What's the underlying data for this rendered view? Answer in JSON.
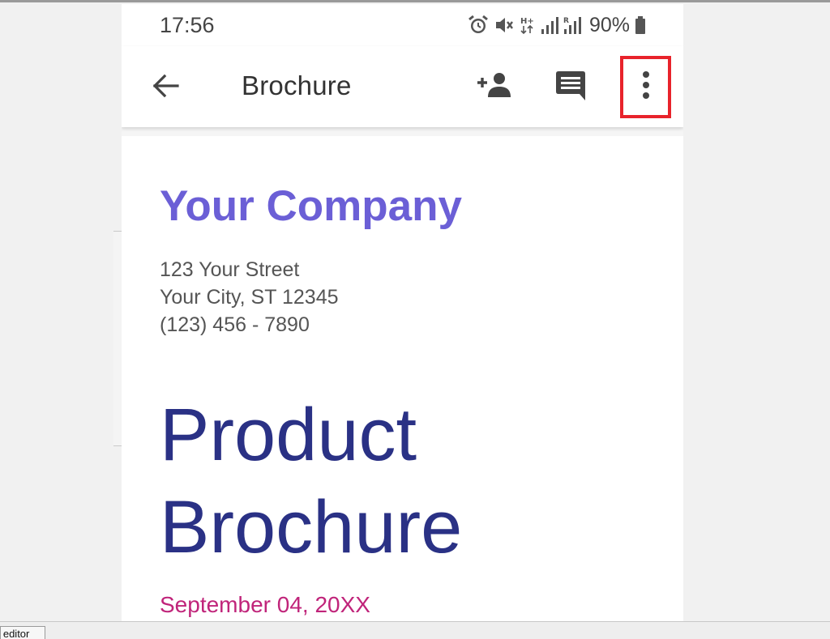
{
  "status_bar": {
    "time": "17:56",
    "icons": [
      "alarm-icon",
      "mute-vibrate-icon",
      "hplus-data-icon",
      "signal-icon",
      "roaming-signal-icon",
      "battery-icon"
    ],
    "battery_percent": "90%"
  },
  "app_bar": {
    "title": "Brochure",
    "actions": [
      "back-arrow-icon",
      "add-person-icon",
      "comment-icon",
      "more-vert-icon"
    ],
    "highlight_color": "#e8232b"
  },
  "document": {
    "company": "Your Company",
    "address_lines": [
      "123 Your Street",
      "Your City, ST 12345",
      "(123) 456 - 7890"
    ],
    "title_lines": [
      "Product",
      "Brochure"
    ],
    "date": "September 04, 20XX",
    "colors": {
      "company": "#6b5fd6",
      "title": "#2a3185",
      "date": "#c0247a"
    }
  },
  "taskbar": {
    "tab_label": "o editor"
  }
}
